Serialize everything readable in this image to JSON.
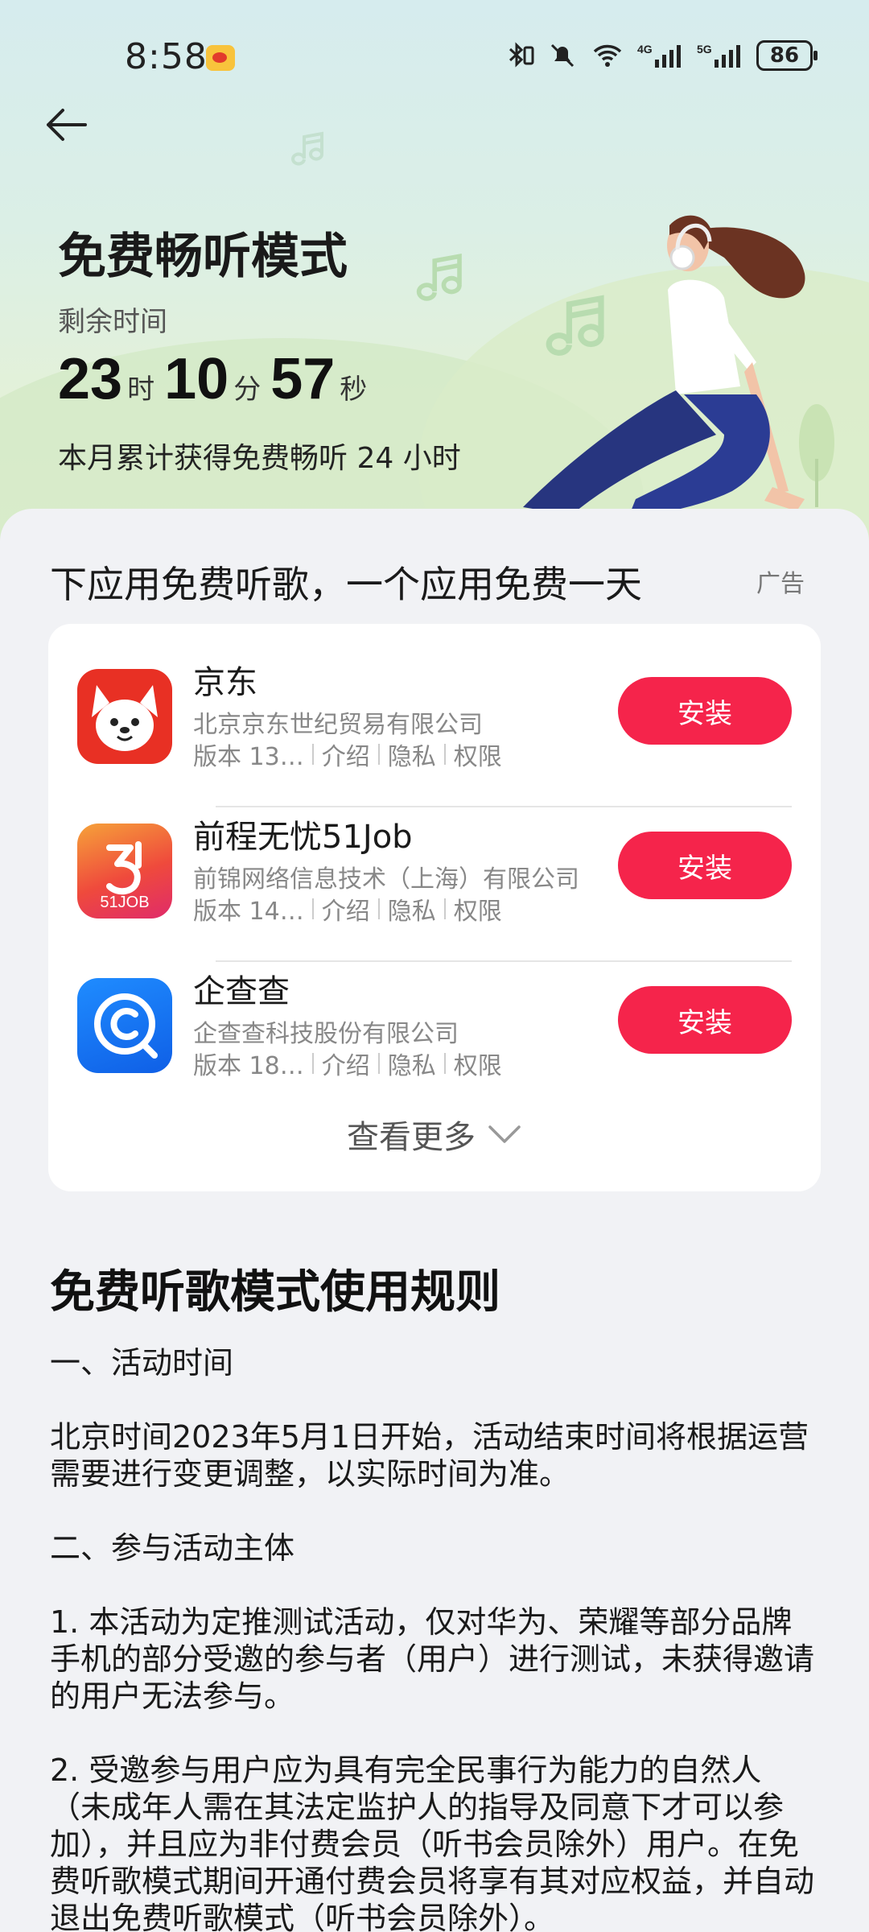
{
  "status_bar": {
    "time": "8:58",
    "battery": "86",
    "icons": [
      "weibo-icon",
      "bluetooth-icon",
      "mute-icon",
      "wifi-icon",
      "4g-signal-icon",
      "5g-signal-icon",
      "battery-icon"
    ]
  },
  "header": {
    "title": "免费畅听模式",
    "remaining_label": "剩余时间",
    "hours": "23",
    "hours_unit": "时",
    "minutes": "10",
    "minutes_unit": "分",
    "seconds": "57",
    "seconds_unit": "秒",
    "monthly_text": "本月累计获得免费畅听 24 小时"
  },
  "ad_section": {
    "heading": "下应用免费听歌，一个应用免费一天",
    "ad_tag": "广告",
    "apps": [
      {
        "name": "京东",
        "developer": "北京京东世纪贸易有限公司",
        "version": "版本 13…",
        "intro": "介绍",
        "privacy": "隐私",
        "permissions": "权限",
        "install": "安装"
      },
      {
        "name": "前程无忧51Job",
        "developer": "前锦网络信息技术（上海）有限公司",
        "version": "版本 14…",
        "intro": "介绍",
        "privacy": "隐私",
        "permissions": "权限",
        "install": "安装",
        "icon_text": "51JOB"
      },
      {
        "name": "企查查",
        "developer": "企查查科技股份有限公司",
        "version": "版本 18…",
        "intro": "介绍",
        "privacy": "隐私",
        "permissions": "权限",
        "install": "安装"
      }
    ],
    "more": "查看更多"
  },
  "rules": {
    "title": "免费听歌模式使用规则",
    "s1_title": "一、活动时间",
    "s1_body": "北京时间2023年5月1日开始，活动结束时间将根据运营需要进行变更调整，以实际时间为准。",
    "s2_title": "二、参与活动主体",
    "s2_p1": "1. 本活动为定推测试活动，仅对华为、荣耀等部分品牌手机的部分受邀的参与者（用户）进行测试，未获得邀请的用户无法参与。",
    "s2_p2": "2. 受邀参与用户应为具有完全民事行为能力的自然人（未成年人需在其法定监护人的指导及同意下才可以参加），并且应为非付费会员（听书会员除外）用户。在免费听歌模式期间开通付费会员将享有其对应权益，并自动退出免费听歌模式（听书会员除外）。"
  }
}
